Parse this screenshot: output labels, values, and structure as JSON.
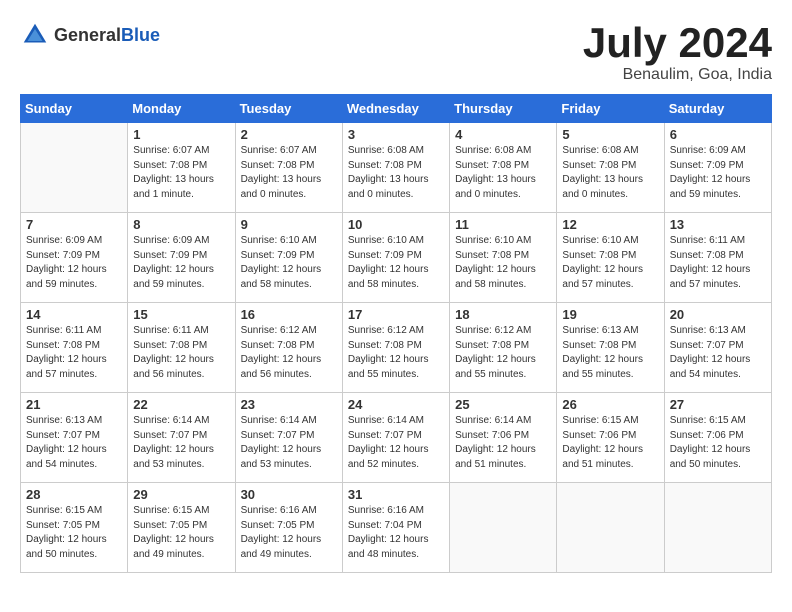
{
  "header": {
    "logo_general": "General",
    "logo_blue": "Blue",
    "month_title": "July 2024",
    "location": "Benaulim, Goa, India"
  },
  "days_of_week": [
    "Sunday",
    "Monday",
    "Tuesday",
    "Wednesday",
    "Thursday",
    "Friday",
    "Saturday"
  ],
  "weeks": [
    [
      {
        "day": "",
        "content": ""
      },
      {
        "day": "1",
        "content": "Sunrise: 6:07 AM\nSunset: 7:08 PM\nDaylight: 13 hours\nand 1 minute."
      },
      {
        "day": "2",
        "content": "Sunrise: 6:07 AM\nSunset: 7:08 PM\nDaylight: 13 hours\nand 0 minutes."
      },
      {
        "day": "3",
        "content": "Sunrise: 6:08 AM\nSunset: 7:08 PM\nDaylight: 13 hours\nand 0 minutes."
      },
      {
        "day": "4",
        "content": "Sunrise: 6:08 AM\nSunset: 7:08 PM\nDaylight: 13 hours\nand 0 minutes."
      },
      {
        "day": "5",
        "content": "Sunrise: 6:08 AM\nSunset: 7:08 PM\nDaylight: 13 hours\nand 0 minutes."
      },
      {
        "day": "6",
        "content": "Sunrise: 6:09 AM\nSunset: 7:09 PM\nDaylight: 12 hours\nand 59 minutes."
      }
    ],
    [
      {
        "day": "7",
        "content": "Sunrise: 6:09 AM\nSunset: 7:09 PM\nDaylight: 12 hours\nand 59 minutes."
      },
      {
        "day": "8",
        "content": "Sunrise: 6:09 AM\nSunset: 7:09 PM\nDaylight: 12 hours\nand 59 minutes."
      },
      {
        "day": "9",
        "content": "Sunrise: 6:10 AM\nSunset: 7:09 PM\nDaylight: 12 hours\nand 58 minutes."
      },
      {
        "day": "10",
        "content": "Sunrise: 6:10 AM\nSunset: 7:09 PM\nDaylight: 12 hours\nand 58 minutes."
      },
      {
        "day": "11",
        "content": "Sunrise: 6:10 AM\nSunset: 7:08 PM\nDaylight: 12 hours\nand 58 minutes."
      },
      {
        "day": "12",
        "content": "Sunrise: 6:10 AM\nSunset: 7:08 PM\nDaylight: 12 hours\nand 57 minutes."
      },
      {
        "day": "13",
        "content": "Sunrise: 6:11 AM\nSunset: 7:08 PM\nDaylight: 12 hours\nand 57 minutes."
      }
    ],
    [
      {
        "day": "14",
        "content": "Sunrise: 6:11 AM\nSunset: 7:08 PM\nDaylight: 12 hours\nand 57 minutes."
      },
      {
        "day": "15",
        "content": "Sunrise: 6:11 AM\nSunset: 7:08 PM\nDaylight: 12 hours\nand 56 minutes."
      },
      {
        "day": "16",
        "content": "Sunrise: 6:12 AM\nSunset: 7:08 PM\nDaylight: 12 hours\nand 56 minutes."
      },
      {
        "day": "17",
        "content": "Sunrise: 6:12 AM\nSunset: 7:08 PM\nDaylight: 12 hours\nand 55 minutes."
      },
      {
        "day": "18",
        "content": "Sunrise: 6:12 AM\nSunset: 7:08 PM\nDaylight: 12 hours\nand 55 minutes."
      },
      {
        "day": "19",
        "content": "Sunrise: 6:13 AM\nSunset: 7:08 PM\nDaylight: 12 hours\nand 55 minutes."
      },
      {
        "day": "20",
        "content": "Sunrise: 6:13 AM\nSunset: 7:07 PM\nDaylight: 12 hours\nand 54 minutes."
      }
    ],
    [
      {
        "day": "21",
        "content": "Sunrise: 6:13 AM\nSunset: 7:07 PM\nDaylight: 12 hours\nand 54 minutes."
      },
      {
        "day": "22",
        "content": "Sunrise: 6:14 AM\nSunset: 7:07 PM\nDaylight: 12 hours\nand 53 minutes."
      },
      {
        "day": "23",
        "content": "Sunrise: 6:14 AM\nSunset: 7:07 PM\nDaylight: 12 hours\nand 53 minutes."
      },
      {
        "day": "24",
        "content": "Sunrise: 6:14 AM\nSunset: 7:07 PM\nDaylight: 12 hours\nand 52 minutes."
      },
      {
        "day": "25",
        "content": "Sunrise: 6:14 AM\nSunset: 7:06 PM\nDaylight: 12 hours\nand 51 minutes."
      },
      {
        "day": "26",
        "content": "Sunrise: 6:15 AM\nSunset: 7:06 PM\nDaylight: 12 hours\nand 51 minutes."
      },
      {
        "day": "27",
        "content": "Sunrise: 6:15 AM\nSunset: 7:06 PM\nDaylight: 12 hours\nand 50 minutes."
      }
    ],
    [
      {
        "day": "28",
        "content": "Sunrise: 6:15 AM\nSunset: 7:05 PM\nDaylight: 12 hours\nand 50 minutes."
      },
      {
        "day": "29",
        "content": "Sunrise: 6:15 AM\nSunset: 7:05 PM\nDaylight: 12 hours\nand 49 minutes."
      },
      {
        "day": "30",
        "content": "Sunrise: 6:16 AM\nSunset: 7:05 PM\nDaylight: 12 hours\nand 49 minutes."
      },
      {
        "day": "31",
        "content": "Sunrise: 6:16 AM\nSunset: 7:04 PM\nDaylight: 12 hours\nand 48 minutes."
      },
      {
        "day": "",
        "content": ""
      },
      {
        "day": "",
        "content": ""
      },
      {
        "day": "",
        "content": ""
      }
    ]
  ]
}
